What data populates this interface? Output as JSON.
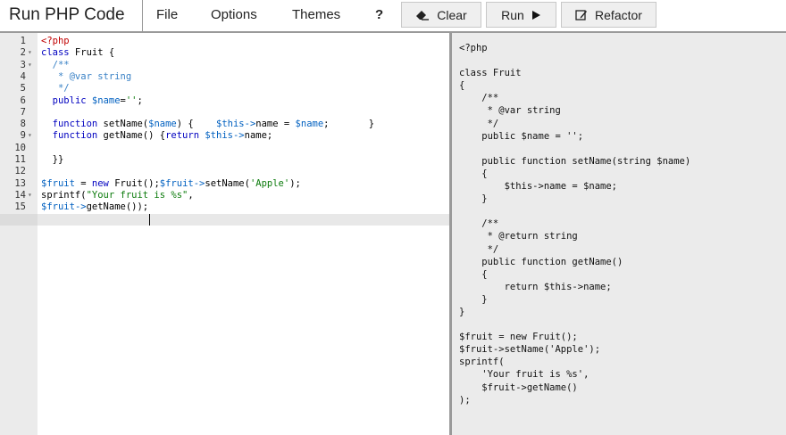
{
  "toolbar": {
    "title": "Run PHP Code",
    "menu": [
      "File",
      "Options",
      "Themes"
    ],
    "help_label": "?",
    "clear_label": "Clear",
    "run_label": "Run",
    "refactor_label": "Refactor"
  },
  "editor": {
    "active_line": 15,
    "fold_markers": [
      2,
      3,
      9,
      14
    ],
    "lines": [
      "<?php",
      "class Fruit {",
      "  /**",
      "   * @var string",
      "   */",
      "  public $name='';",
      "",
      "  function setName($name) {    $this->name = $name;       }",
      "  function getName() {return $this->name;",
      "",
      "  }}",
      "",
      "$fruit = new Fruit();$fruit->setName('Apple');",
      "sprintf(\"Your fruit is %s\",",
      "$fruit->getName());"
    ]
  },
  "output": {
    "text": "<?php\n\nclass Fruit\n{\n    /**\n     * @var string\n     */\n    public $name = '';\n\n    public function setName(string $name)\n    {\n        $this->name = $name;\n    }\n\n    /**\n     * @return string\n     */\n    public function getName()\n    {\n        return $this->name;\n    }\n}\n\n$fruit = new Fruit();\n$fruit->setName('Apple');\nsprintf(\n    'Your fruit is %s',\n    $fruit->getName()\n);"
  }
}
